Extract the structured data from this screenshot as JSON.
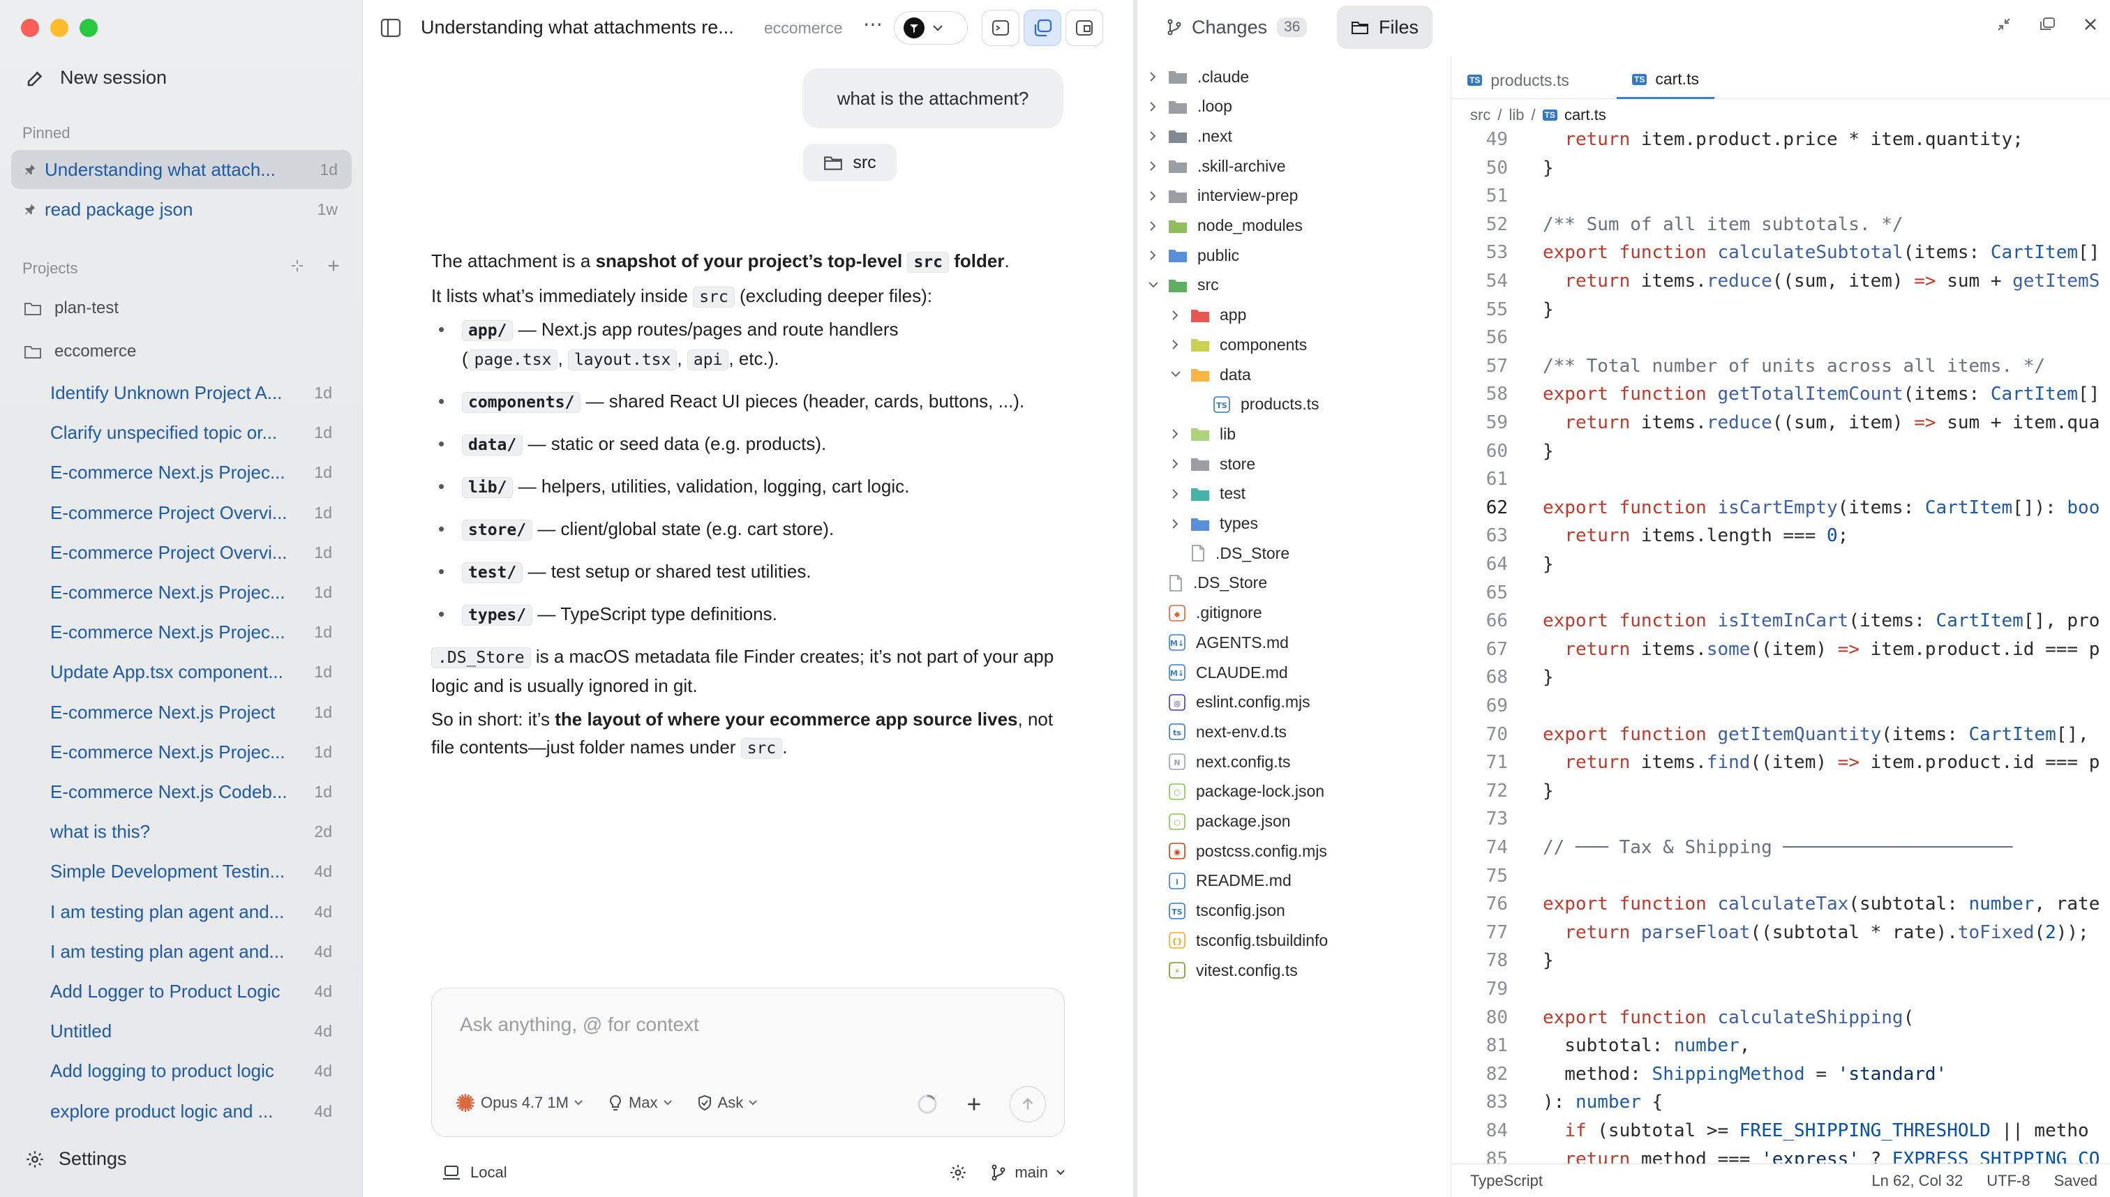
{
  "sidebar": {
    "new_session": "New session",
    "pinned_label": "Pinned",
    "pinned": [
      {
        "label": "Understanding what attach...",
        "age": "1d"
      },
      {
        "label": "read package json",
        "age": "1w"
      }
    ],
    "projects_label": "Projects",
    "projects": [
      "plan-test",
      "eccomerce"
    ],
    "sessions": [
      {
        "label": "Identify Unknown Project A...",
        "age": "1d"
      },
      {
        "label": "Clarify unspecified topic or...",
        "age": "1d"
      },
      {
        "label": "E-commerce Next.js Projec...",
        "age": "1d"
      },
      {
        "label": "E-commerce Project Overvi...",
        "age": "1d"
      },
      {
        "label": "E-commerce Project Overvi...",
        "age": "1d"
      },
      {
        "label": "E-commerce Next.js Projec...",
        "age": "1d"
      },
      {
        "label": "E-commerce Next.js Projec...",
        "age": "1d"
      },
      {
        "label": "Update App.tsx component...",
        "age": "1d"
      },
      {
        "label": "E-commerce Next.js Project",
        "age": "1d"
      },
      {
        "label": "E-commerce Next.js Projec...",
        "age": "1d"
      },
      {
        "label": "E-commerce Next.js Codeb...",
        "age": "1d"
      },
      {
        "label": "what is this?",
        "age": "2d"
      },
      {
        "label": "Simple Development Testin...",
        "age": "4d"
      },
      {
        "label": "I am testing plan agent and...",
        "age": "4d"
      },
      {
        "label": "I am testing plan agent and...",
        "age": "4d"
      },
      {
        "label": "Add Logger to Product Logic",
        "age": "4d"
      },
      {
        "label": "Untitled",
        "age": "4d"
      },
      {
        "label": "Add logging to product logic",
        "age": "4d"
      },
      {
        "label": "explore product logic and ...",
        "age": "4d"
      }
    ],
    "settings": "Settings"
  },
  "chat": {
    "title": "Understanding what attachments re...",
    "project": "eccomerce",
    "user_message": "what is the attachment?",
    "attachment": "src",
    "answer": {
      "p1_a": "The attachment is a ",
      "p1_b": "snapshot of your project’s top-level ",
      "p1_code": "src",
      "p1_c": " folder",
      "p1_d": ".",
      "p2_a": "It lists what’s immediately inside ",
      "p2_code": "src",
      "p2_b": " (excluding deeper files):",
      "items": [
        {
          "code": "app/",
          "text": " — Next.js app routes/pages and route handlers"
        },
        {
          "code": "components/",
          "text": " — shared React UI pieces (header, cards, buttons, ...)."
        },
        {
          "code": "data/",
          "text": " — static or seed data (e.g. products)."
        },
        {
          "code": "lib/",
          "text": " — helpers, utilities, validation, logging, cart logic."
        },
        {
          "code": "store/",
          "text": " — client/global state (e.g. cart store)."
        },
        {
          "code": "test/",
          "text": " — test setup or shared test utilities."
        },
        {
          "code": "types/",
          "text": " — TypeScript type definitions."
        }
      ],
      "app_sub": {
        "open": "(",
        "c1": "page.tsx",
        "sep1": ", ",
        "c2": "layout.tsx",
        "sep2": ", ",
        "c3": "api",
        "close": ", etc.)."
      },
      "ds_code": ".DS_Store",
      "ds_text": " is a macOS metadata file Finder creates; it’s not part of your app logic and is usually ignored in git.",
      "final_a": "So in short: it’s ",
      "final_b": "the layout of where your ecommerce app source lives",
      "final_c": ", not file contents—just folder names under ",
      "final_code": "src",
      "final_d": "."
    },
    "composer": {
      "placeholder": "Ask anything, @ for context",
      "model": "Opus 4.7 1M",
      "effort": "Max",
      "mode": "Ask"
    },
    "footer": {
      "location": "Local",
      "branch": "main"
    }
  },
  "panel": {
    "tabs": {
      "changes": "Changes",
      "changes_count": "36",
      "files": "Files"
    },
    "tree": [
      {
        "name": ".claude",
        "type": "folder",
        "depth": 0,
        "open": false,
        "color": "#8a8d92"
      },
      {
        "name": ".loop",
        "type": "folder",
        "depth": 0,
        "open": false,
        "color": "#8a8d92"
      },
      {
        "name": ".next",
        "type": "folder",
        "depth": 0,
        "open": false,
        "color": "#6b7480"
      },
      {
        "name": ".skill-archive",
        "type": "folder",
        "depth": 0,
        "open": false,
        "color": "#8a8d92"
      },
      {
        "name": "interview-prep",
        "type": "folder",
        "depth": 0,
        "open": false,
        "color": "#8a8d92"
      },
      {
        "name": "node_modules",
        "type": "folder",
        "depth": 0,
        "open": false,
        "color": "#7cb342"
      },
      {
        "name": "public",
        "type": "folder",
        "depth": 0,
        "open": false,
        "color": "#3a7bd5"
      },
      {
        "name": "src",
        "type": "folder",
        "depth": 0,
        "open": true,
        "color": "#43a047"
      },
      {
        "name": "app",
        "type": "folder",
        "depth": 1,
        "open": false,
        "color": "#e53935"
      },
      {
        "name": "components",
        "type": "folder",
        "depth": 1,
        "open": false,
        "color": "#c0ca33"
      },
      {
        "name": "data",
        "type": "folder",
        "depth": 1,
        "open": true,
        "color": "#f9a825"
      },
      {
        "name": "products.ts",
        "type": "ts",
        "depth": 2
      },
      {
        "name": "lib",
        "type": "folder",
        "depth": 1,
        "open": false,
        "color": "#9ccc65"
      },
      {
        "name": "store",
        "type": "folder",
        "depth": 1,
        "open": false,
        "color": "#8a8d92"
      },
      {
        "name": "test",
        "type": "folder",
        "depth": 1,
        "open": false,
        "color": "#26a69a"
      },
      {
        "name": "types",
        "type": "folder",
        "depth": 1,
        "open": false,
        "color": "#3a7bd5"
      },
      {
        "name": ".DS_Store",
        "type": "file",
        "depth": 1
      },
      {
        "name": ".DS_Store",
        "type": "file",
        "depth": 0
      },
      {
        "name": ".gitignore",
        "type": "git",
        "depth": 0
      },
      {
        "name": "AGENTS.md",
        "type": "md",
        "depth": 0
      },
      {
        "name": "CLAUDE.md",
        "type": "md",
        "depth": 0
      },
      {
        "name": "eslint.config.mjs",
        "type": "eslint",
        "depth": 0
      },
      {
        "name": "next-env.d.ts",
        "type": "dts",
        "depth": 0
      },
      {
        "name": "next.config.ts",
        "type": "next",
        "depth": 0
      },
      {
        "name": "package-lock.json",
        "type": "npm",
        "depth": 0
      },
      {
        "name": "package.json",
        "type": "npm",
        "depth": 0
      },
      {
        "name": "postcss.config.mjs",
        "type": "postcss",
        "depth": 0
      },
      {
        "name": "README.md",
        "type": "info",
        "depth": 0
      },
      {
        "name": "tsconfig.json",
        "type": "tsconfig",
        "depth": 0
      },
      {
        "name": "tsconfig.tsbuildinfo",
        "type": "braces",
        "depth": 0
      },
      {
        "name": "vitest.config.ts",
        "type": "vitest",
        "depth": 0
      }
    ],
    "editor_tabs": [
      "products.ts",
      "cart.ts"
    ],
    "crumbs": [
      "src",
      "lib",
      "cart.ts"
    ],
    "code": [
      {
        "n": "49",
        "h": "  <span class='k'>return</span> item.product.price * item.quantity;"
      },
      {
        "n": "50",
        "h": "}"
      },
      {
        "n": "51",
        "h": ""
      },
      {
        "n": "52",
        "h": "<span class='cm'>/** Sum of all item subtotals. */</span>"
      },
      {
        "n": "53",
        "h": "<span class='k'>export function</span> <span class='f'>calculateSubtotal</span>(items: <span class='t'>CartItem</span>[]"
      },
      {
        "n": "54",
        "h": "  <span class='k'>return</span> items.<span class='f'>reduce</span>((sum, item) <span class='k'>=></span> sum + <span class='f'>getItemS</span>"
      },
      {
        "n": "55",
        "h": "}"
      },
      {
        "n": "56",
        "h": ""
      },
      {
        "n": "57",
        "h": "<span class='cm'>/** Total number of units across all items. */</span>"
      },
      {
        "n": "58",
        "h": "<span class='k'>export function</span> <span class='f'>getTotalItemCount</span>(items: <span class='t'>CartItem</span>[]"
      },
      {
        "n": "59",
        "h": "  <span class='k'>return</span> items.<span class='f'>reduce</span>((sum, item) <span class='k'>=></span> sum + item.qua"
      },
      {
        "n": "60",
        "h": "}"
      },
      {
        "n": "61",
        "h": ""
      },
      {
        "n": "62",
        "h": "<span class='k'>export function</span> <span class='f'>isCartEmpty</span>(items: <span class='t'>CartItem</span>[]): <span class='t'>boo</span>"
      },
      {
        "n": "63",
        "h": "  <span class='k'>return</span> items.length === <span class='n'>0</span>;"
      },
      {
        "n": "64",
        "h": "}"
      },
      {
        "n": "65",
        "h": ""
      },
      {
        "n": "66",
        "h": "<span class='k'>export function</span> <span class='f'>isItemInCart</span>(items: <span class='t'>CartItem</span>[], pro"
      },
      {
        "n": "67",
        "h": "  <span class='k'>return</span> items.<span class='f'>some</span>((item) <span class='k'>=></span> item.product.id === p"
      },
      {
        "n": "68",
        "h": "}"
      },
      {
        "n": "69",
        "h": ""
      },
      {
        "n": "70",
        "h": "<span class='k'>export function</span> <span class='f'>getItemQuantity</span>(items: <span class='t'>CartItem</span>[], "
      },
      {
        "n": "71",
        "h": "  <span class='k'>return</span> items.<span class='f'>find</span>((item) <span class='k'>=></span> item.product.id === p"
      },
      {
        "n": "72",
        "h": "}"
      },
      {
        "n": "73",
        "h": ""
      },
      {
        "n": "74",
        "h": "<span class='cm'>// ─── Tax &amp; Shipping ─────────────────────</span>"
      },
      {
        "n": "75",
        "h": ""
      },
      {
        "n": "76",
        "h": "<span class='k'>export function</span> <span class='f'>calculateTax</span>(subtotal: <span class='t'>number</span>, rate"
      },
      {
        "n": "77",
        "h": "  <span class='k'>return</span> <span class='f'>parseFloat</span>((subtotal * rate).<span class='f'>toFixed</span>(<span class='n'>2</span>));"
      },
      {
        "n": "78",
        "h": "}"
      },
      {
        "n": "79",
        "h": ""
      },
      {
        "n": "80",
        "h": "<span class='k'>export function</span> <span class='f'>calculateShipping</span>("
      },
      {
        "n": "81",
        "h": "  subtotal: <span class='t'>number</span>,"
      },
      {
        "n": "82",
        "h": "  method: <span class='t'>ShippingMethod</span> = <span class='s'>'standard'</span>"
      },
      {
        "n": "83",
        "h": "): <span class='t'>number</span> {"
      },
      {
        "n": "84",
        "h": "  <span class='k'>if</span> (subtotal >= <span class='n'>FREE_SHIPPING_THRESHOLD</span> || metho"
      },
      {
        "n": "85",
        "h": "  <span class='k'>return</span> method === <span class='s'>'express'</span> ? <span class='n'>EXPRESS_SHIPPING_CO</span>"
      }
    ],
    "status": {
      "language": "TypeScript",
      "cursor": "Ln 62, Col 32",
      "encoding": "UTF-8",
      "saved": "Saved"
    }
  }
}
